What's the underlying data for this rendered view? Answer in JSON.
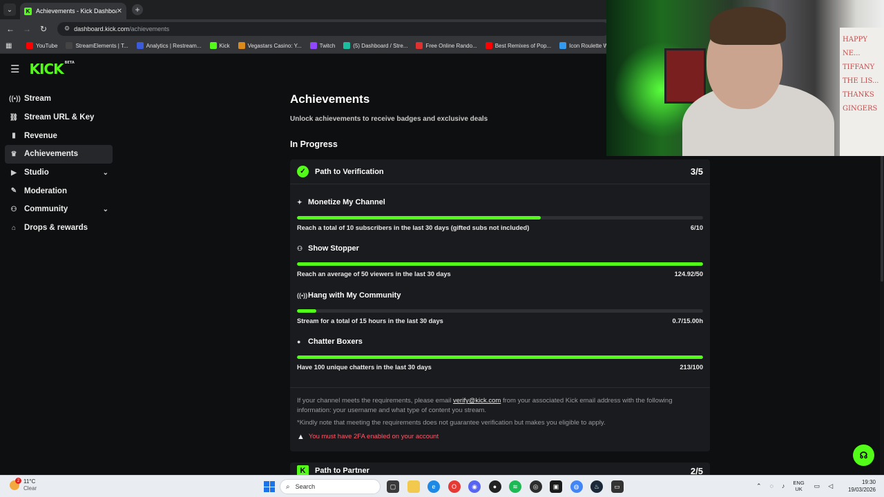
{
  "browser": {
    "tab_title": "Achievements - Kick Dashboard",
    "url_host": "dashboard.kick.com",
    "url_path": "/achievements",
    "bookmarks": [
      {
        "label": "YouTube",
        "icon": "youtube-icon",
        "color": "#ff0000"
      },
      {
        "label": "StreamElements | T...",
        "icon": "streamelements-icon",
        "color": "#444444"
      },
      {
        "label": "Analytics | Restream...",
        "icon": "restream-icon",
        "color": "#3b5bdb"
      },
      {
        "label": "Kick",
        "icon": "kick-icon",
        "color": "#53fc18"
      },
      {
        "label": "Vegastars Casino: Y...",
        "icon": "casino-icon",
        "color": "#d98a1a"
      },
      {
        "label": "Twitch",
        "icon": "twitch-icon",
        "color": "#9146ff"
      },
      {
        "label": "(5) Dashboard / Stre...",
        "icon": "dashboard-icon",
        "color": "#1bbfa0"
      },
      {
        "label": "Free Online Rando...",
        "icon": "random-icon",
        "color": "#e03131"
      },
      {
        "label": "Best Remixes of Pop...",
        "icon": "youtube-icon",
        "color": "#ff0000"
      },
      {
        "label": "Icon Roulette Whe...",
        "icon": "roulette-icon",
        "color": "#339af0"
      }
    ]
  },
  "sidebar": {
    "items": [
      {
        "label": "Stream",
        "icon": "broadcast-icon",
        "active": false,
        "chevron": false
      },
      {
        "label": "Stream URL & Key",
        "icon": "link-icon",
        "active": false,
        "chevron": false
      },
      {
        "label": "Revenue",
        "icon": "chart-icon",
        "active": false,
        "chevron": false
      },
      {
        "label": "Achievements",
        "icon": "trophy-icon",
        "active": true,
        "chevron": false
      },
      {
        "label": "Studio",
        "icon": "video-icon",
        "active": false,
        "chevron": true
      },
      {
        "label": "Moderation",
        "icon": "wrench-icon",
        "active": false,
        "chevron": false
      },
      {
        "label": "Community",
        "icon": "people-icon",
        "active": false,
        "chevron": true
      },
      {
        "label": "Drops & rewards",
        "icon": "gift-icon",
        "active": false,
        "chevron": false
      }
    ]
  },
  "main": {
    "title": "Achievements",
    "subtitle": "Unlock achievements to receive badges and exclusive deals",
    "section": "In Progress",
    "verification": {
      "title": "Path to Verification",
      "count": "3/5",
      "achievements": [
        {
          "title": "Monetize My Channel",
          "icon": "sparkle-icon",
          "desc": "Reach a total of 10 subscribers in the last 30 days (gifted subs not included)",
          "value": "6/10",
          "progress": 0.6
        },
        {
          "title": "Show Stopper",
          "icon": "viewers-icon",
          "desc": "Reach an average of 50 viewers in the last 30 days",
          "value": "124.92/50",
          "progress": 1.0
        },
        {
          "title": "Hang with My Community",
          "icon": "signal-icon",
          "desc": "Stream for a total of 15 hours in the last 30 days",
          "value": "0.7/15.00h",
          "progress": 0.047
        },
        {
          "title": "Chatter Boxers",
          "icon": "chat-icon",
          "desc": "Have 100 unique chatters in the last 30 days",
          "value": "213/100",
          "progress": 1.0
        }
      ],
      "footer_pre": "If your channel meets the requirements, please email ",
      "footer_email": "verify@kick.com",
      "footer_post": " from your associated Kick email address with the following information: your username and what type of content you stream.",
      "note": "*Kindly note that meeting the requirements does not guarantee verification but makes you eligible to apply.",
      "warning": "You must have 2FA enabled on your account"
    },
    "partner": {
      "title": "Path to Partner",
      "count": "2/5"
    }
  },
  "webcam": {
    "board_text": "HAPPY NE... TIFFANY THE LIS... THANKS GINGERS"
  },
  "taskbar": {
    "weather_temp": "11°C",
    "weather_cond": "Clear",
    "weather_badge": "2",
    "search_label": "Search",
    "lang_top": "ENG",
    "lang_bottom": "UK",
    "time": "19:30",
    "date": "19/03/2026"
  },
  "colors": {
    "accent": "#53fc18",
    "warning": "#ff5b6b"
  }
}
